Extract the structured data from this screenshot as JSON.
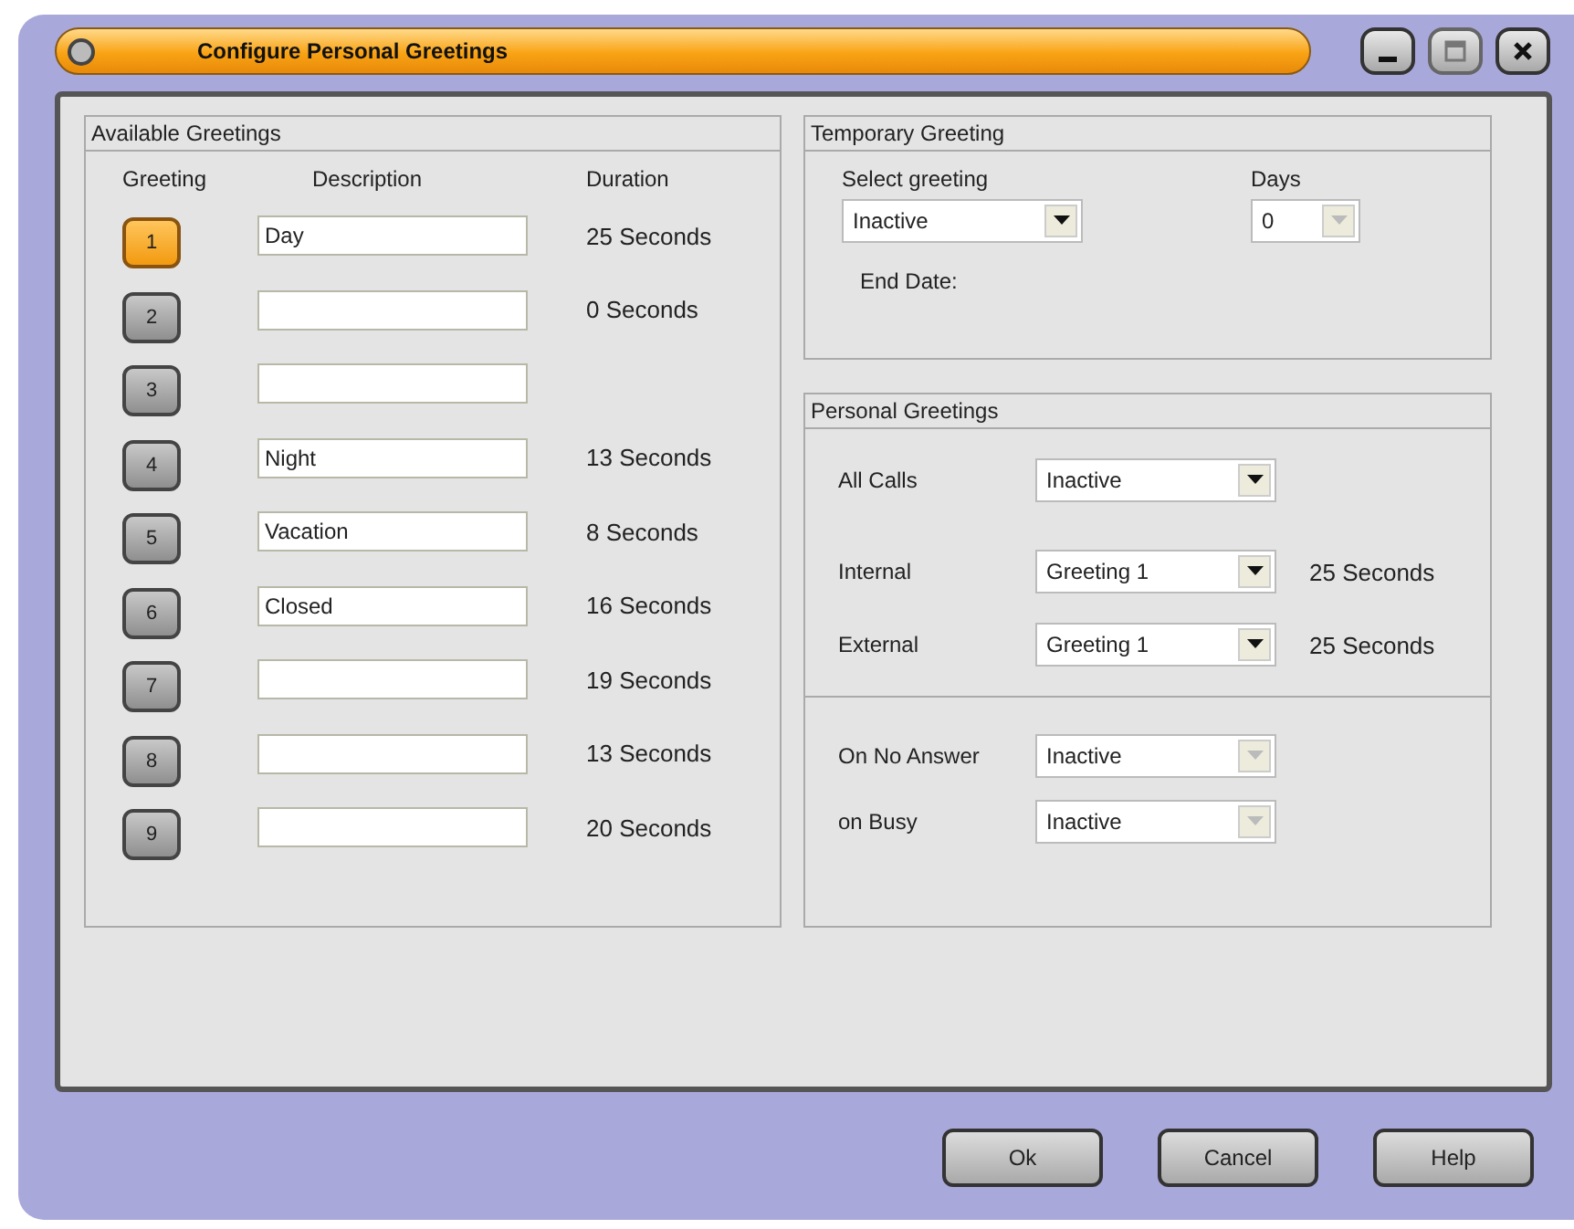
{
  "window": {
    "title": "Configure Personal Greetings"
  },
  "available_greetings": {
    "title": "Available Greetings",
    "columns": [
      "Greeting",
      "Description",
      "Duration"
    ],
    "rows": [
      {
        "number": "1",
        "selected": true,
        "description": "Day",
        "duration": "25 Seconds"
      },
      {
        "number": "2",
        "selected": false,
        "duration": "0 Seconds"
      },
      {
        "number": "3",
        "selected": false
      },
      {
        "number": "4",
        "selected": false,
        "description": "Night",
        "duration": "13 Seconds"
      },
      {
        "number": "5",
        "selected": false,
        "description": "Vacation",
        "duration": "8 Seconds"
      },
      {
        "number": "6",
        "selected": false,
        "description": "Closed",
        "duration": "16 Seconds"
      },
      {
        "number": "7",
        "selected": false,
        "duration": "19 Seconds"
      },
      {
        "number": "8",
        "selected": false,
        "duration": "13 Seconds"
      },
      {
        "number": "9",
        "selected": false,
        "duration": "20 Seconds"
      }
    ]
  },
  "temporary_greeting": {
    "title": "Temporary Greeting",
    "select_label": "Select greeting",
    "select": {
      "value": "Inactive",
      "disabled": false
    },
    "days_label": "Days",
    "days": {
      "value": "0",
      "disabled": true
    },
    "end_date_label": "End Date:"
  },
  "personal_greetings": {
    "title": "Personal Greetings",
    "sections": [
      [
        {
          "label": "All Calls",
          "value": "Inactive",
          "disabled": false
        },
        {
          "label": "Internal",
          "value": "Greeting 1",
          "disabled": false,
          "duration": "25 Seconds"
        },
        {
          "label": "External",
          "value": "Greeting 1",
          "disabled": false,
          "duration": "25 Seconds"
        }
      ],
      [
        {
          "label": "On No Answer",
          "value": "Inactive",
          "disabled": true
        },
        {
          "label": "on Busy",
          "value": "Inactive",
          "disabled": true
        }
      ]
    ]
  },
  "buttons": [
    "Ok",
    "Cancel",
    "Help"
  ]
}
